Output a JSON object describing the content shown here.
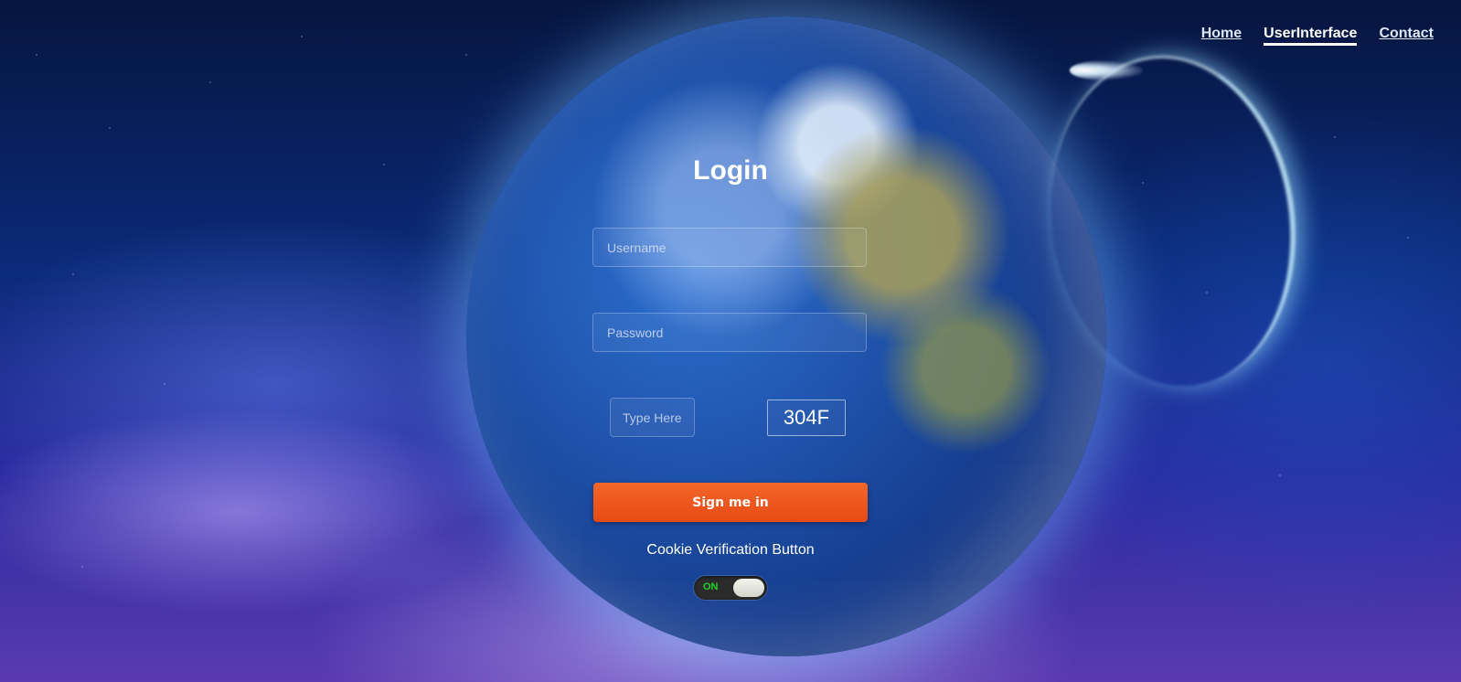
{
  "nav": {
    "items": [
      {
        "label": "Home",
        "active": false
      },
      {
        "label": "UserInterface",
        "active": true
      },
      {
        "label": "Contact",
        "active": false
      }
    ]
  },
  "login": {
    "title": "Login",
    "username_placeholder": "Username",
    "password_placeholder": "Password",
    "captcha_placeholder": "Type Here",
    "captcha_code": "304F",
    "submit_label": "Sign me in",
    "cookie_label": "Cookie Verification Button",
    "toggle_state": "ON"
  },
  "colors": {
    "accent": "#e84a14",
    "toggle_on": "#22d422"
  }
}
